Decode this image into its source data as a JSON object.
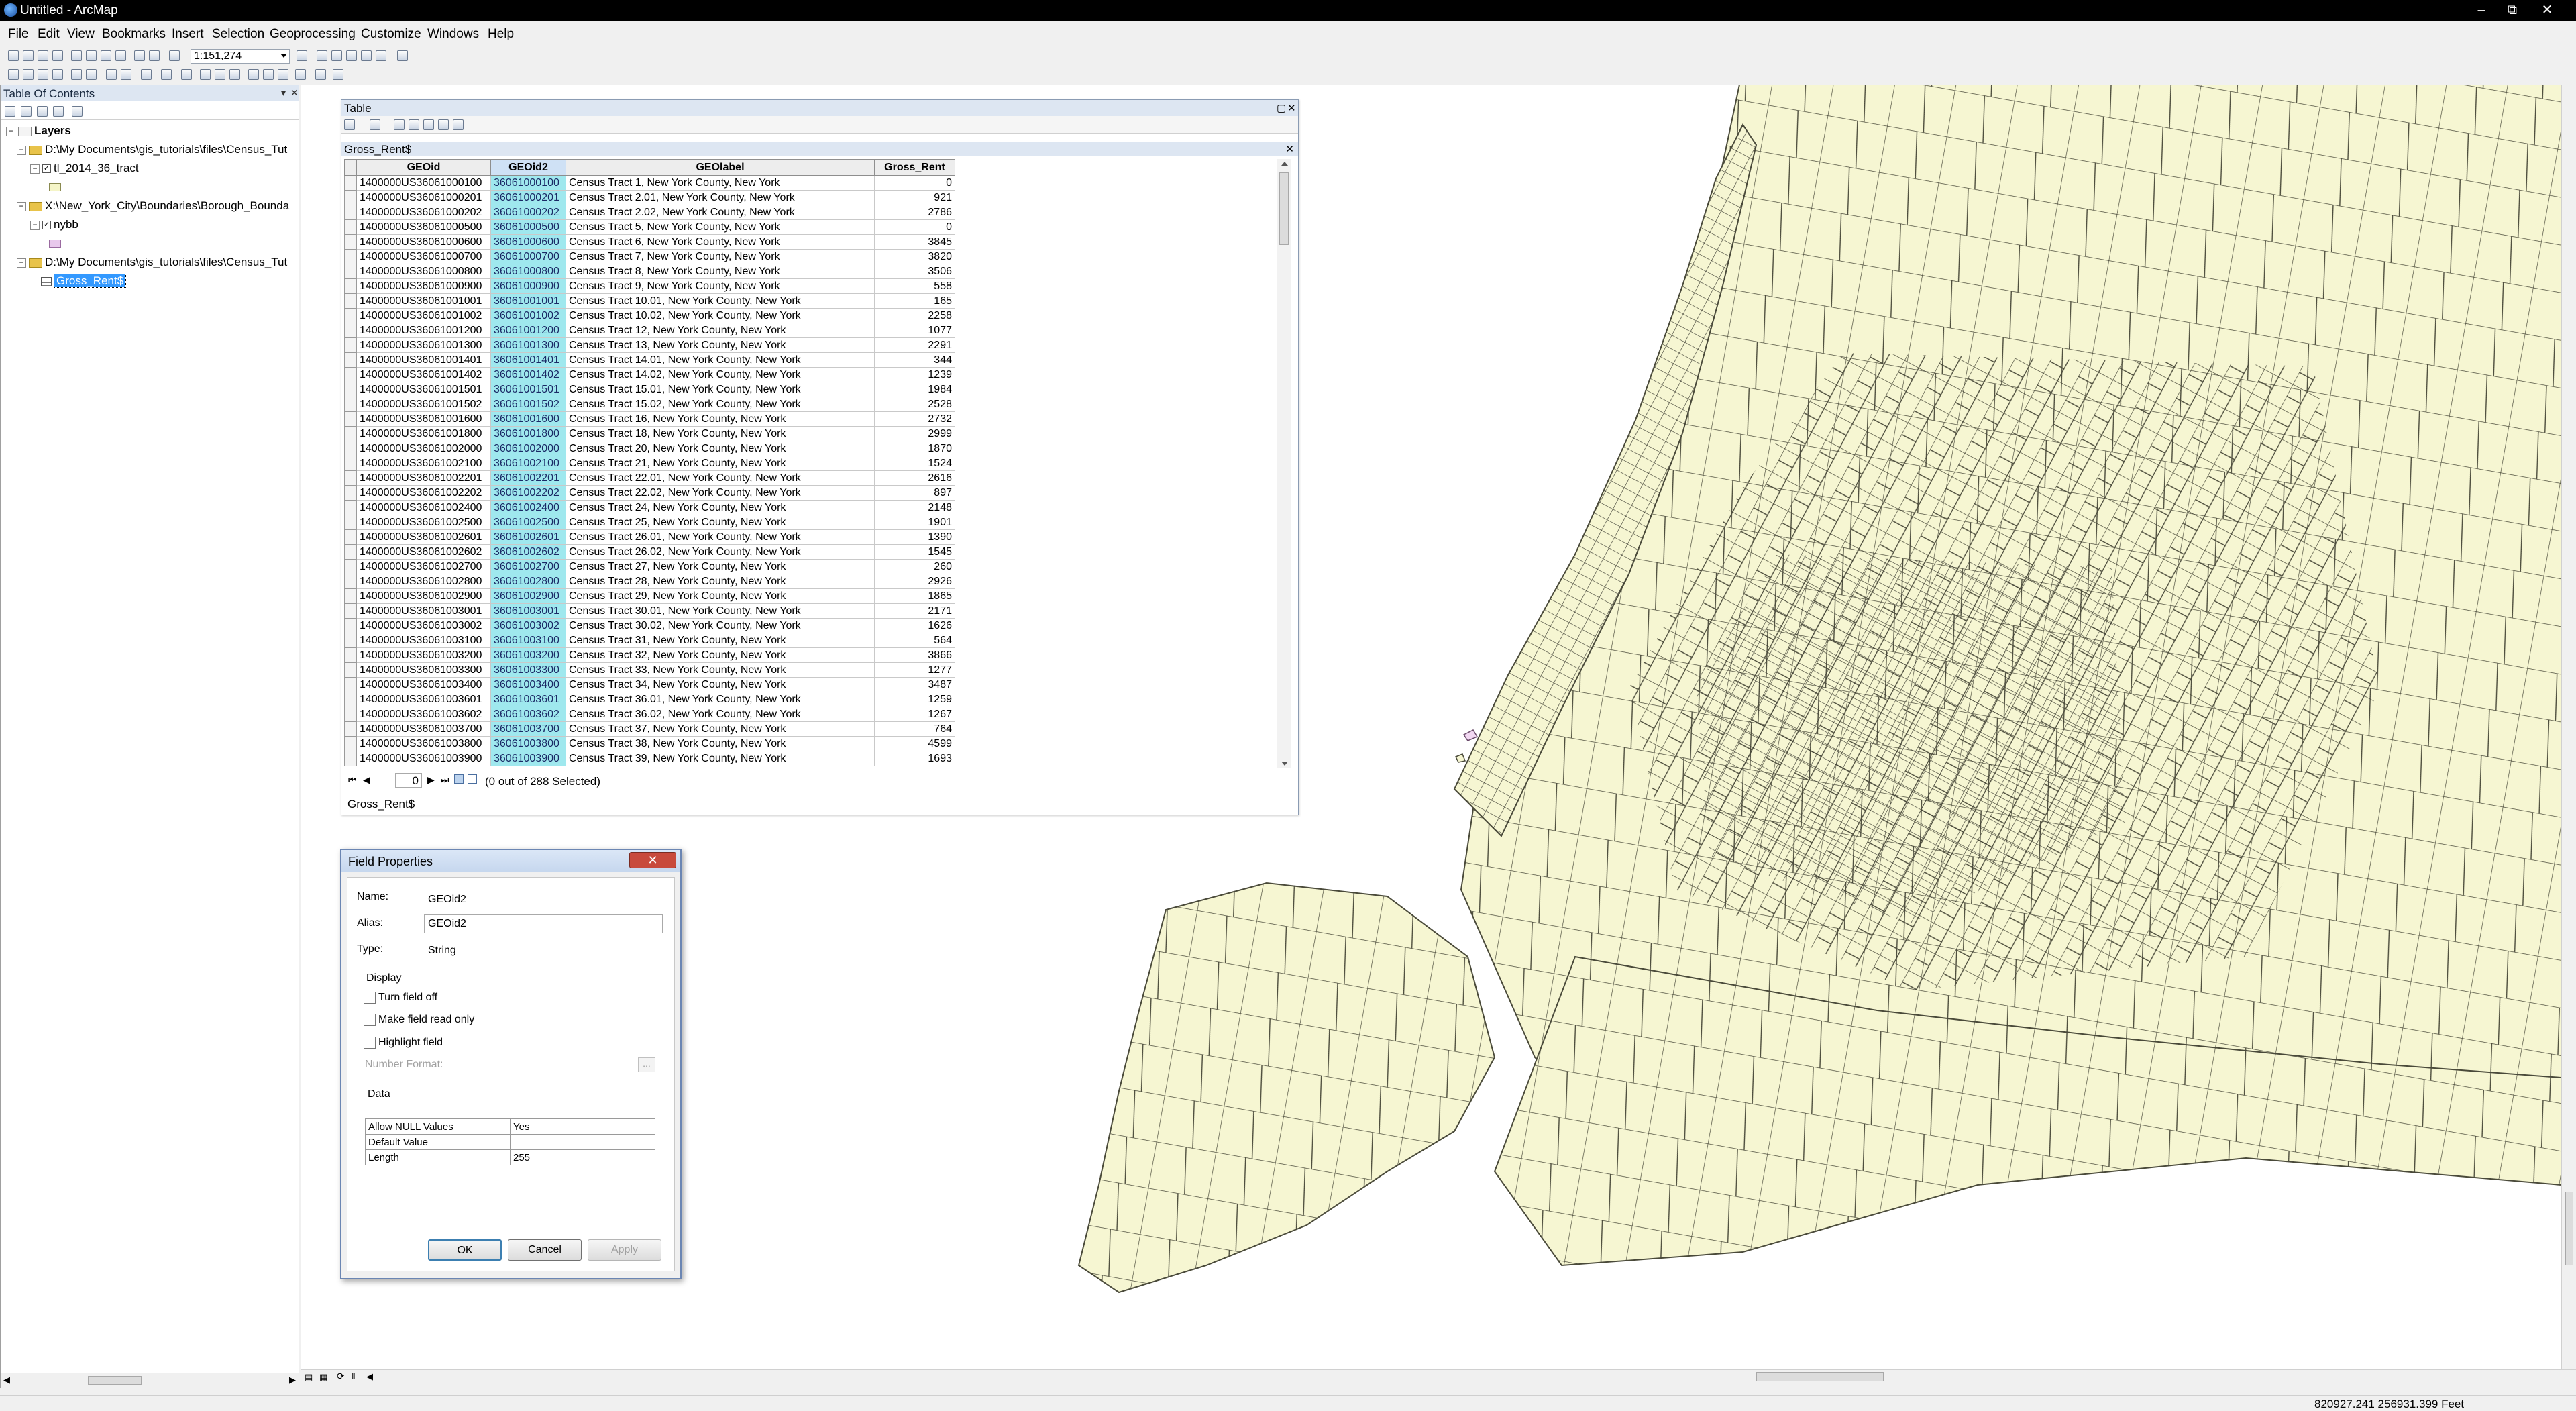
{
  "window": {
    "title": "Untitled - ArcMap",
    "controls": [
      "–",
      "⧉",
      "✕"
    ]
  },
  "menu": [
    "File",
    "Edit",
    "View",
    "Bookmarks",
    "Insert",
    "Selection",
    "Geoprocessing",
    "Customize",
    "Windows",
    "Help"
  ],
  "toolbar": {
    "scale": "1:151,274"
  },
  "toc": {
    "title": "Table Of Contents",
    "root": "Layers",
    "groups": [
      {
        "path": "D:\\My Documents\\gis_tutorials\\files\\Census_Tut",
        "layer": "tl_2014_36_tract",
        "swatch_color": "#f5f5c8"
      },
      {
        "path": "X:\\New_York_City\\Boundaries\\Borough_Bounda",
        "layer": "nybb",
        "swatch_color": "#e8c8ec"
      },
      {
        "path": "D:\\My Documents\\gis_tutorials\\files\\Census_Tut",
        "layer": "Gross_Rent$"
      }
    ]
  },
  "table_window": {
    "title": "Table",
    "tab_title": "Gross_Rent$",
    "columns": [
      "GEOid",
      "GEOid2",
      "GEOlabel",
      "Gross_Rent"
    ],
    "rows": [
      [
        "1400000US36061000100",
        "36061000100",
        "Census Tract 1, New York County, New York",
        "0"
      ],
      [
        "1400000US36061000201",
        "36061000201",
        "Census Tract 2.01, New York County, New York",
        "921"
      ],
      [
        "1400000US36061000202",
        "36061000202",
        "Census Tract 2.02, New York County, New York",
        "2786"
      ],
      [
        "1400000US36061000500",
        "36061000500",
        "Census Tract 5, New York County, New York",
        "0"
      ],
      [
        "1400000US36061000600",
        "36061000600",
        "Census Tract 6, New York County, New York",
        "3845"
      ],
      [
        "1400000US36061000700",
        "36061000700",
        "Census Tract 7, New York County, New York",
        "3820"
      ],
      [
        "1400000US36061000800",
        "36061000800",
        "Census Tract 8, New York County, New York",
        "3506"
      ],
      [
        "1400000US36061000900",
        "36061000900",
        "Census Tract 9, New York County, New York",
        "558"
      ],
      [
        "1400000US36061001001",
        "36061001001",
        "Census Tract 10.01, New York County, New York",
        "165"
      ],
      [
        "1400000US36061001002",
        "36061001002",
        "Census Tract 10.02, New York County, New York",
        "2258"
      ],
      [
        "1400000US36061001200",
        "36061001200",
        "Census Tract 12, New York County, New York",
        "1077"
      ],
      [
        "1400000US36061001300",
        "36061001300",
        "Census Tract 13, New York County, New York",
        "2291"
      ],
      [
        "1400000US36061001401",
        "36061001401",
        "Census Tract 14.01, New York County, New York",
        "344"
      ],
      [
        "1400000US36061001402",
        "36061001402",
        "Census Tract 14.02, New York County, New York",
        "1239"
      ],
      [
        "1400000US36061001501",
        "36061001501",
        "Census Tract 15.01, New York County, New York",
        "1984"
      ],
      [
        "1400000US36061001502",
        "36061001502",
        "Census Tract 15.02, New York County, New York",
        "2528"
      ],
      [
        "1400000US36061001600",
        "36061001600",
        "Census Tract 16, New York County, New York",
        "2732"
      ],
      [
        "1400000US36061001800",
        "36061001800",
        "Census Tract 18, New York County, New York",
        "2999"
      ],
      [
        "1400000US36061002000",
        "36061002000",
        "Census Tract 20, New York County, New York",
        "1870"
      ],
      [
        "1400000US36061002100",
        "36061002100",
        "Census Tract 21, New York County, New York",
        "1524"
      ],
      [
        "1400000US36061002201",
        "36061002201",
        "Census Tract 22.01, New York County, New York",
        "2616"
      ],
      [
        "1400000US36061002202",
        "36061002202",
        "Census Tract 22.02, New York County, New York",
        "897"
      ],
      [
        "1400000US36061002400",
        "36061002400",
        "Census Tract 24, New York County, New York",
        "2148"
      ],
      [
        "1400000US36061002500",
        "36061002500",
        "Census Tract 25, New York County, New York",
        "1901"
      ],
      [
        "1400000US36061002601",
        "36061002601",
        "Census Tract 26.01, New York County, New York",
        "1390"
      ],
      [
        "1400000US36061002602",
        "36061002602",
        "Census Tract 26.02, New York County, New York",
        "1545"
      ],
      [
        "1400000US36061002700",
        "36061002700",
        "Census Tract 27, New York County, New York",
        "260"
      ],
      [
        "1400000US36061002800",
        "36061002800",
        "Census Tract 28, New York County, New York",
        "2926"
      ],
      [
        "1400000US36061002900",
        "36061002900",
        "Census Tract 29, New York County, New York",
        "1865"
      ],
      [
        "1400000US36061003001",
        "36061003001",
        "Census Tract 30.01, New York County, New York",
        "2171"
      ],
      [
        "1400000US36061003002",
        "36061003002",
        "Census Tract 30.02, New York County, New York",
        "1626"
      ],
      [
        "1400000US36061003100",
        "36061003100",
        "Census Tract 31, New York County, New York",
        "564"
      ],
      [
        "1400000US36061003200",
        "36061003200",
        "Census Tract 32, New York County, New York",
        "3866"
      ],
      [
        "1400000US36061003300",
        "36061003300",
        "Census Tract 33, New York County, New York",
        "1277"
      ],
      [
        "1400000US36061003400",
        "36061003400",
        "Census Tract 34, New York County, New York",
        "3487"
      ],
      [
        "1400000US36061003601",
        "36061003601",
        "Census Tract 36.01, New York County, New York",
        "1259"
      ],
      [
        "1400000US36061003602",
        "36061003602",
        "Census Tract 36.02, New York County, New York",
        "1267"
      ],
      [
        "1400000US36061003700",
        "36061003700",
        "Census Tract 37, New York County, New York",
        "764"
      ],
      [
        "1400000US36061003800",
        "36061003800",
        "Census Tract 38, New York County, New York",
        "4599"
      ],
      [
        "1400000US36061003900",
        "36061003900",
        "Census Tract 39, New York County, New York",
        "1693"
      ]
    ],
    "record": "0",
    "selection_status": "(0 out of 288 Selected)",
    "bottom_tab": "Gross_Rent$"
  },
  "field_dialog": {
    "title": "Field Properties",
    "name_label": "Name:",
    "name_value": "GEOid2",
    "alias_label": "Alias:",
    "alias_value": "GEOid2",
    "type_label": "Type:",
    "type_value": "String",
    "display_heading": "Display",
    "turn_off": "Turn field off",
    "read_only": "Make field read only",
    "highlight": "Highlight field",
    "number_format": "Number Format:",
    "ellipsis": "...",
    "data_heading": "Data",
    "properties": [
      [
        "Allow NULL Values",
        "Yes"
      ],
      [
        "Default Value",
        ""
      ],
      [
        "Length",
        "255"
      ]
    ],
    "ok": "OK",
    "cancel": "Cancel",
    "apply": "Apply"
  },
  "status": {
    "coords": "820927.241  256931.399 Feet"
  },
  "colors": {
    "map_fill": "#f6f6d2",
    "highlight": "#9fe8ee",
    "selection": "#3399ff"
  }
}
